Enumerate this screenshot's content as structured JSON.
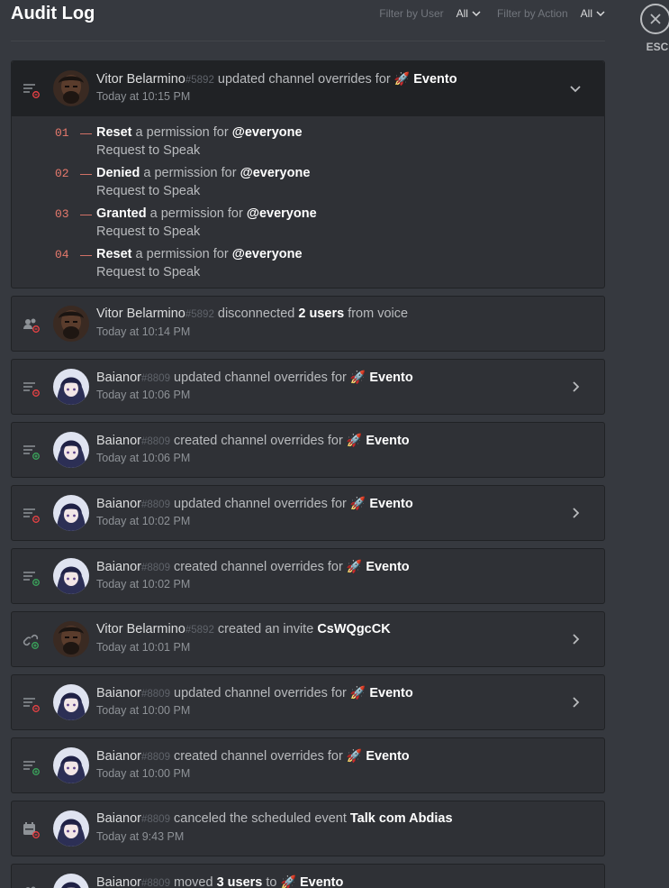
{
  "header": {
    "title": "Audit Log",
    "filter_user_label": "Filter by User",
    "filter_user_value": "All",
    "filter_action_label": "Filter by Action",
    "filter_action_value": "All"
  },
  "close": {
    "esc_label": "ESC"
  },
  "entries": [
    {
      "user": "Vitor Belarmino",
      "disc": "#5892",
      "action": "updated channel overrides for",
      "target_emoji": "🚀",
      "target": "Evento",
      "time": "Today at 10:15 PM",
      "icon": "channel-update-icon",
      "changes": [
        {
          "num": "01",
          "verb": "Reset",
          "mid": "a permission for",
          "who": "@everyone",
          "perm": "Request to Speak"
        },
        {
          "num": "02",
          "verb": "Denied",
          "mid": "a permission for",
          "who": "@everyone",
          "perm": "Request to Speak"
        },
        {
          "num": "03",
          "verb": "Granted",
          "mid": "a permission for",
          "who": "@everyone",
          "perm": "Request to Speak"
        },
        {
          "num": "04",
          "verb": "Reset",
          "mid": "a permission for",
          "who": "@everyone",
          "perm": "Request to Speak"
        }
      ]
    },
    {
      "user": "Vitor Belarmino",
      "disc": "#5892",
      "action": "disconnected",
      "target": "2 users",
      "suffix": "from voice",
      "time": "Today at 10:14 PM",
      "icon": "member-disconnect-icon"
    },
    {
      "user": "Baianor",
      "disc": "#8809",
      "action": "updated channel overrides for",
      "target_emoji": "🚀",
      "target": "Evento",
      "time": "Today at 10:06 PM",
      "icon": "channel-update-icon"
    },
    {
      "user": "Baianor",
      "disc": "#8809",
      "action": "created channel overrides for",
      "target_emoji": "🚀",
      "target": "Evento",
      "time": "Today at 10:06 PM",
      "icon": "channel-create-icon"
    },
    {
      "user": "Baianor",
      "disc": "#8809",
      "action": "updated channel overrides for",
      "target_emoji": "🚀",
      "target": "Evento",
      "time": "Today at 10:02 PM",
      "icon": "channel-update-icon"
    },
    {
      "user": "Baianor",
      "disc": "#8809",
      "action": "created channel overrides for",
      "target_emoji": "🚀",
      "target": "Evento",
      "time": "Today at 10:02 PM",
      "icon": "channel-create-icon"
    },
    {
      "user": "Vitor Belarmino",
      "disc": "#5892",
      "action": "created an invite",
      "target": "CsWQgcCK",
      "time": "Today at 10:01 PM",
      "icon": "invite-create-icon"
    },
    {
      "user": "Baianor",
      "disc": "#8809",
      "action": "updated channel overrides for",
      "target_emoji": "🚀",
      "target": "Evento",
      "time": "Today at 10:00 PM",
      "icon": "channel-update-icon"
    },
    {
      "user": "Baianor",
      "disc": "#8809",
      "action": "created channel overrides for",
      "target_emoji": "🚀",
      "target": "Evento",
      "time": "Today at 10:00 PM",
      "icon": "channel-create-icon"
    },
    {
      "user": "Baianor",
      "disc": "#8809",
      "action": "canceled the scheduled event",
      "target": "Talk com Abdias",
      "time": "Today at 9:43 PM",
      "icon": "event-cancel-icon"
    },
    {
      "user": "Baianor",
      "disc": "#8809",
      "action": "moved",
      "target": "3 users",
      "suffix_to": "to",
      "target_emoji": "🚀",
      "target2": "Evento",
      "time": "",
      "icon": "member-move-icon"
    }
  ],
  "colors": {
    "background": "#36393f",
    "card": "#2f3136",
    "accent_red": "#ed4245",
    "accent_green": "#3ba55c"
  }
}
